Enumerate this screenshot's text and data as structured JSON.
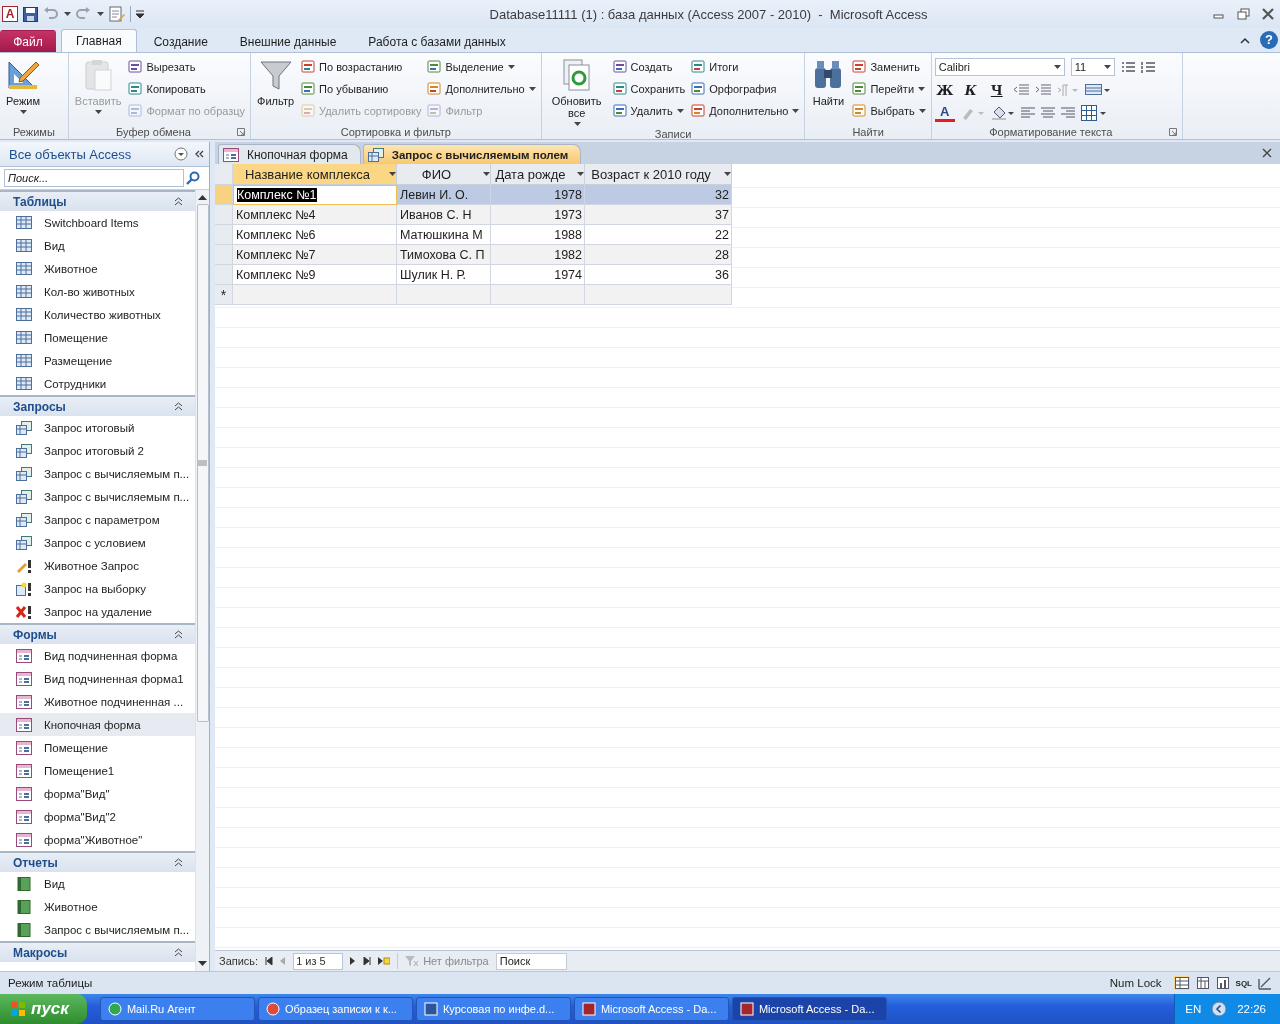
{
  "window": {
    "title": "Database11111 (1) : база данных (Access 2007 - 2010)  -  Microsoft Access",
    "app_icon": "A"
  },
  "ribbon_tabs": [
    {
      "label": "Файл",
      "kind": "file",
      "selected": false
    },
    {
      "label": "Главная",
      "kind": "tab",
      "selected": true
    },
    {
      "label": "Создание",
      "kind": "tab",
      "selected": false
    },
    {
      "label": "Внешние данные",
      "kind": "tab",
      "selected": false
    },
    {
      "label": "Работа с базами данных",
      "kind": "tab",
      "selected": false
    }
  ],
  "help": "?",
  "ribbon_groups": [
    {
      "label": "Режимы",
      "kind": "buttons",
      "launcher": false,
      "columns": [
        {
          "kind": "large",
          "buttons": [
            {
              "label": "Режим",
              "disabled": false,
              "dropdown": true
            }
          ]
        }
      ]
    },
    {
      "label": "Буфер обмена",
      "kind": "buttons",
      "launcher": true,
      "columns": [
        {
          "kind": "large",
          "buttons": [
            {
              "label": "Вставить",
              "disabled": true,
              "dropdown": true
            }
          ]
        },
        {
          "kind": "small",
          "buttons": [
            {
              "label": "Вырезать",
              "disabled": false,
              "dropdown": false
            },
            {
              "label": "Копировать",
              "disabled": false,
              "dropdown": false
            },
            {
              "label": "Формат по образцу",
              "disabled": true,
              "dropdown": false
            }
          ]
        }
      ]
    },
    {
      "label": "Сортировка и фильтр",
      "kind": "buttons",
      "launcher": false,
      "columns": [
        {
          "kind": "large",
          "buttons": [
            {
              "label": "Фильтр",
              "disabled": false,
              "dropdown": false
            }
          ]
        },
        {
          "kind": "small",
          "buttons": [
            {
              "label": "По возрастанию",
              "disabled": false,
              "dropdown": false
            },
            {
              "label": "По убыванию",
              "disabled": false,
              "dropdown": false
            },
            {
              "label": "Удалить сортировку",
              "disabled": true,
              "dropdown": false
            }
          ]
        },
        {
          "kind": "small",
          "buttons": [
            {
              "label": "Выделение",
              "disabled": false,
              "dropdown": true
            },
            {
              "label": "Дополнительно",
              "disabled": false,
              "dropdown": true
            },
            {
              "label": "Фильтр",
              "disabled": true,
              "dropdown": false
            }
          ]
        }
      ]
    },
    {
      "label": "Записи",
      "kind": "buttons",
      "launcher": false,
      "columns": [
        {
          "kind": "large",
          "buttons": [
            {
              "label": "Обновить все",
              "disabled": false,
              "dropdown": true
            }
          ]
        },
        {
          "kind": "small",
          "buttons": [
            {
              "label": "Создать",
              "disabled": false,
              "dropdown": false
            },
            {
              "label": "Сохранить",
              "disabled": false,
              "dropdown": false
            },
            {
              "label": "Удалить",
              "disabled": false,
              "dropdown": true
            }
          ]
        },
        {
          "kind": "small",
          "buttons": [
            {
              "label": "Итоги",
              "disabled": false,
              "dropdown": false
            },
            {
              "label": "Орфография",
              "disabled": false,
              "dropdown": false
            },
            {
              "label": "Дополнительно",
              "disabled": false,
              "dropdown": true
            }
          ]
        }
      ]
    },
    {
      "label": "Найти",
      "kind": "buttons",
      "launcher": false,
      "columns": [
        {
          "kind": "large",
          "buttons": [
            {
              "label": "Найти",
              "disabled": false,
              "dropdown": false
            }
          ]
        },
        {
          "kind": "small",
          "buttons": [
            {
              "label": "Заменить",
              "disabled": false,
              "dropdown": false
            },
            {
              "label": "Перейти",
              "disabled": false,
              "dropdown": true
            },
            {
              "label": "Выбрать",
              "disabled": false,
              "dropdown": true
            }
          ]
        }
      ]
    },
    {
      "label": "Форматирование текста",
      "kind": "font",
      "launcher": true,
      "font": "Calibri",
      "size": "11",
      "bold": "Ж",
      "italic": "К",
      "underline": "Ч",
      "font_color": "A"
    }
  ],
  "navigation": {
    "title": "Все объекты Access",
    "search_placeholder": "Поиск...",
    "groups": [
      {
        "title": "Таблицы",
        "kind": "table",
        "items": [
          {
            "label": "Switchboard Items",
            "selected": false
          },
          {
            "label": "Вид",
            "selected": false
          },
          {
            "label": "Животное",
            "selected": false
          },
          {
            "label": "Кол-во животных",
            "selected": false
          },
          {
            "label": "Количество животных",
            "selected": false
          },
          {
            "label": "Помещение",
            "selected": false
          },
          {
            "label": "Размещение",
            "selected": false
          },
          {
            "label": "Сотрудники",
            "selected": false
          }
        ]
      },
      {
        "title": "Запросы",
        "kind": "query",
        "items": [
          {
            "label": "Запрос итоговый",
            "kind": "select",
            "selected": false
          },
          {
            "label": "Запрос итоговый 2",
            "kind": "select",
            "selected": false
          },
          {
            "label": "Запрос с вычисляемым п...",
            "kind": "select",
            "selected": false
          },
          {
            "label": "Запрос с вычисляемым п...",
            "kind": "select",
            "selected": false
          },
          {
            "label": "Запрос с параметром",
            "kind": "select",
            "selected": false
          },
          {
            "label": "Запрос с условием",
            "kind": "select",
            "selected": false
          },
          {
            "label": "Животное Запрос",
            "kind": "update",
            "selected": false
          },
          {
            "label": "Запрос на выборку",
            "kind": "make",
            "selected": false
          },
          {
            "label": "Запрос на удаление",
            "kind": "delete",
            "selected": false
          }
        ]
      },
      {
        "title": "Формы",
        "kind": "form",
        "items": [
          {
            "label": "Вид подчиненная форма",
            "selected": false
          },
          {
            "label": "Вид подчиненная форма1",
            "selected": false
          },
          {
            "label": "Животное подчиненная ...",
            "selected": false
          },
          {
            "label": "Кнопочная форма",
            "selected": true
          },
          {
            "label": "Помещение",
            "selected": false
          },
          {
            "label": "Помещение1",
            "selected": false
          },
          {
            "label": "форма\"Вид\"",
            "selected": false
          },
          {
            "label": "форма\"Вид\"2",
            "selected": false
          },
          {
            "label": "форма\"Животное\"",
            "selected": false
          }
        ]
      },
      {
        "title": "Отчеты",
        "kind": "report",
        "items": [
          {
            "label": "Вид",
            "selected": false
          },
          {
            "label": "Животное",
            "selected": false
          },
          {
            "label": "Запрос с вычисляемым п...",
            "selected": false
          }
        ]
      },
      {
        "title": "Макросы"
      }
    ]
  },
  "document_tabs": [
    {
      "label": "Кнопочная форма",
      "kind": "form",
      "selected": false
    },
    {
      "label": "Запрос с вычисляемым полем",
      "kind": "query",
      "selected": true
    }
  ],
  "table": {
    "columns": [
      {
        "label": "Название комплекса",
        "numeric": false,
        "selected": true
      },
      {
        "label": "ФИО",
        "numeric": false,
        "selected": false
      },
      {
        "label": "Дата рожде",
        "numeric": true,
        "selected": false
      },
      {
        "label": "Возраст к 2010 году",
        "numeric": true,
        "selected": false
      }
    ],
    "rows": [
      {
        "selected": true,
        "cells": [
          "Комплекс №1",
          "Левин И. О.",
          "1978",
          "32"
        ]
      },
      {
        "selected": false,
        "cells": [
          "Комплекс №4",
          "Иванов С. Н",
          "1973",
          "37"
        ]
      },
      {
        "selected": false,
        "cells": [
          "Комплекс №6",
          "Матюшкина М",
          "1988",
          "22"
        ]
      },
      {
        "selected": false,
        "cells": [
          "Комплекс №7",
          "Тимохова С. П",
          "1982",
          "28"
        ]
      },
      {
        "selected": false,
        "cells": [
          "Комплекс №9",
          "Шулик Н. Р.",
          "1974",
          "36"
        ]
      }
    ],
    "new_row_marker": "*"
  },
  "record_navigator": {
    "label": "Запись:",
    "position": "1 из 5",
    "filter": "Нет фильтра",
    "search": "Поиск"
  },
  "status_bar": {
    "text": "Режим таблицы",
    "num_lock": "Num Lock",
    "sql": "SQL"
  },
  "taskbar": {
    "start": "пуск",
    "tasks": [
      {
        "label": "Mail.Ru Агент",
        "kind": "mail",
        "selected": false
      },
      {
        "label": "Образец записки к к...",
        "kind": "browser",
        "selected": false
      },
      {
        "label": "Курсовая по инфе.d...",
        "kind": "word",
        "selected": false
      },
      {
        "label": "Microsoft Access - Da...",
        "kind": "access",
        "selected": false
      },
      {
        "label": "Microsoft Access - Da...",
        "kind": "access",
        "selected": true
      }
    ],
    "language": "EN",
    "clock": "22:26"
  }
}
